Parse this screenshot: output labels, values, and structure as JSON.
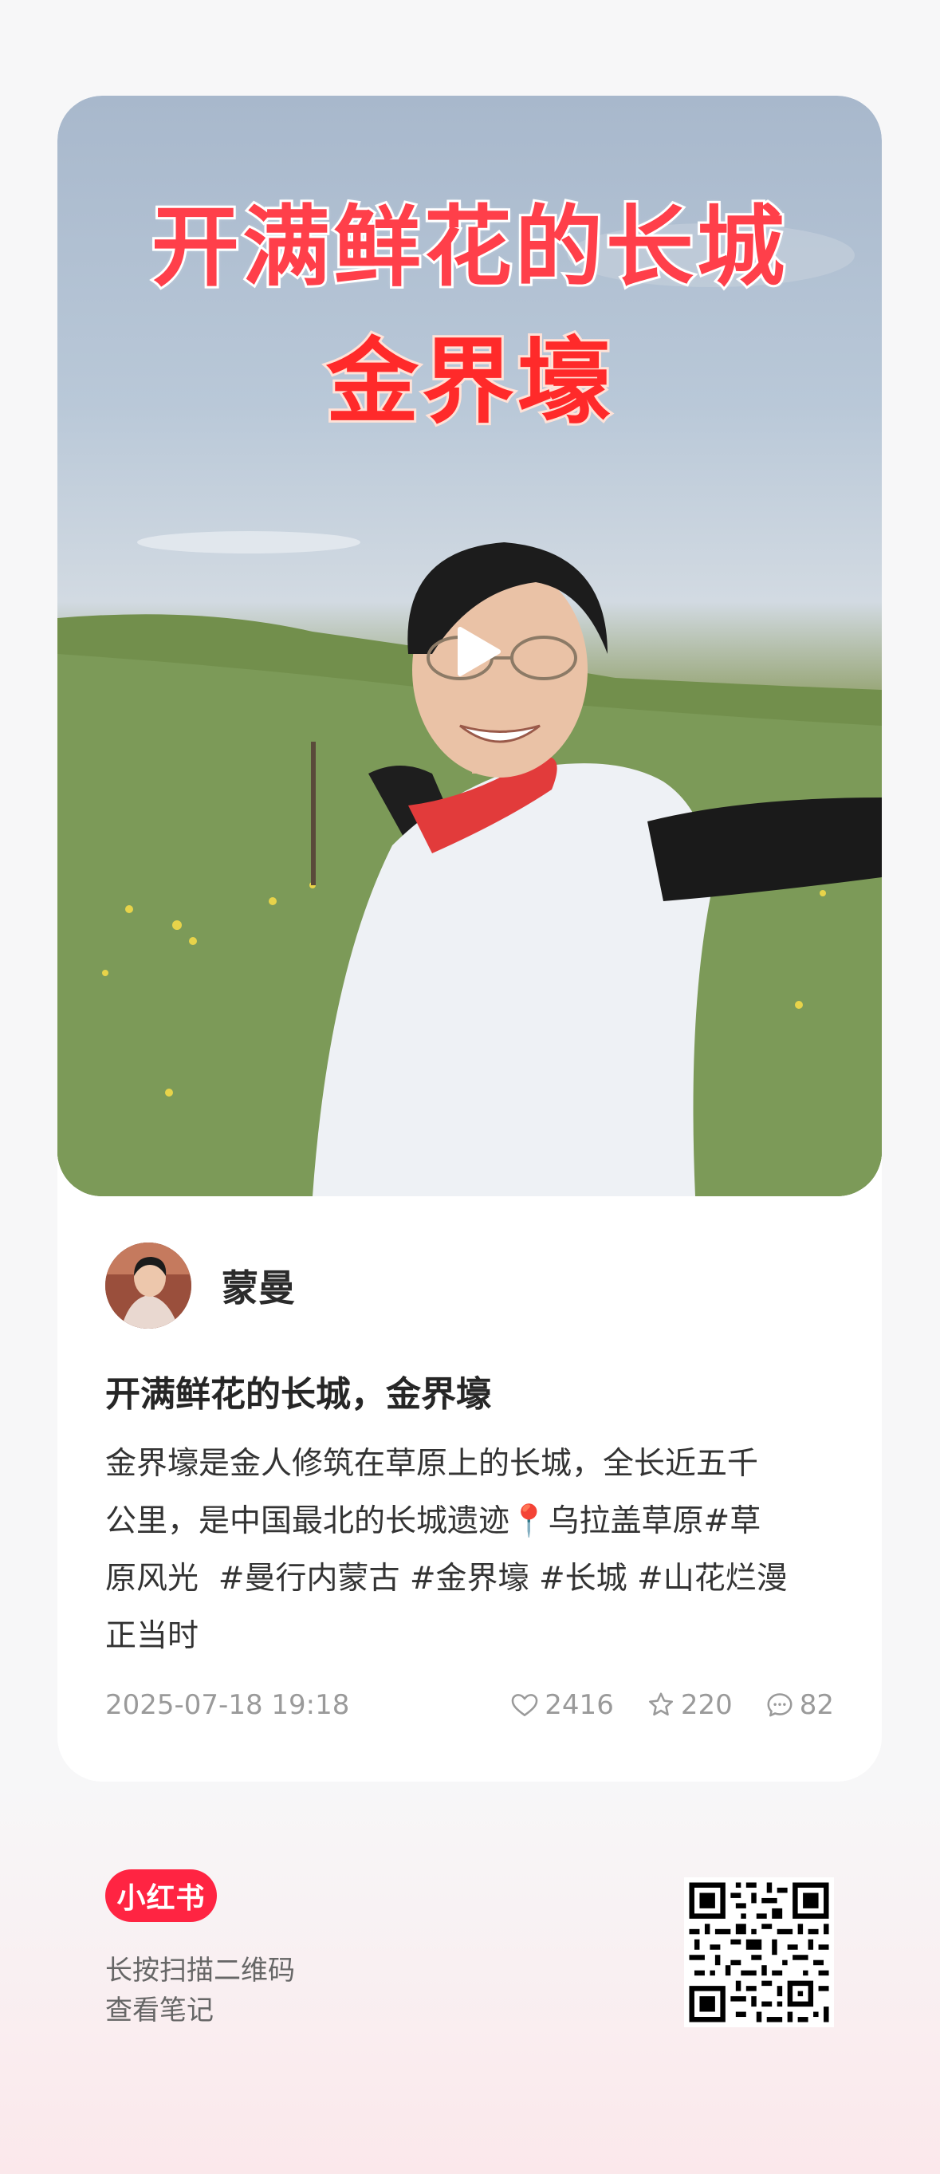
{
  "cover": {
    "title_line1": "开满鲜花的长城",
    "title_line2": "金界壕",
    "play_icon": "play-icon"
  },
  "author": {
    "name": "蒙曼",
    "avatar_icon": "avatar"
  },
  "note": {
    "title": "开满鲜花的长城，金界壕",
    "body_line1": "金界壕是金人修筑在草原上的长城，全长近五千",
    "body_line2": "公里，是中国最北的长城遗迹📍乌拉盖草原#草",
    "body_line3": "原风光  #曼行内蒙古 #金界壕 #长城 #山花烂漫",
    "body_line4": "正当时"
  },
  "meta": {
    "date": "2025-07-18 19:18",
    "likes": "2416",
    "collects": "220",
    "comments": "82",
    "like_icon": "heart-icon",
    "collect_icon": "star-icon",
    "comment_icon": "comment-icon"
  },
  "footer": {
    "logo_text": "小红书",
    "hint_line1": "长按扫描二维码",
    "hint_line2": "查看笔记",
    "qr_icon": "qr-code"
  },
  "colors": {
    "brand": "#ff2442",
    "text_primary": "#262626",
    "text_secondary": "#9a9a9a"
  }
}
